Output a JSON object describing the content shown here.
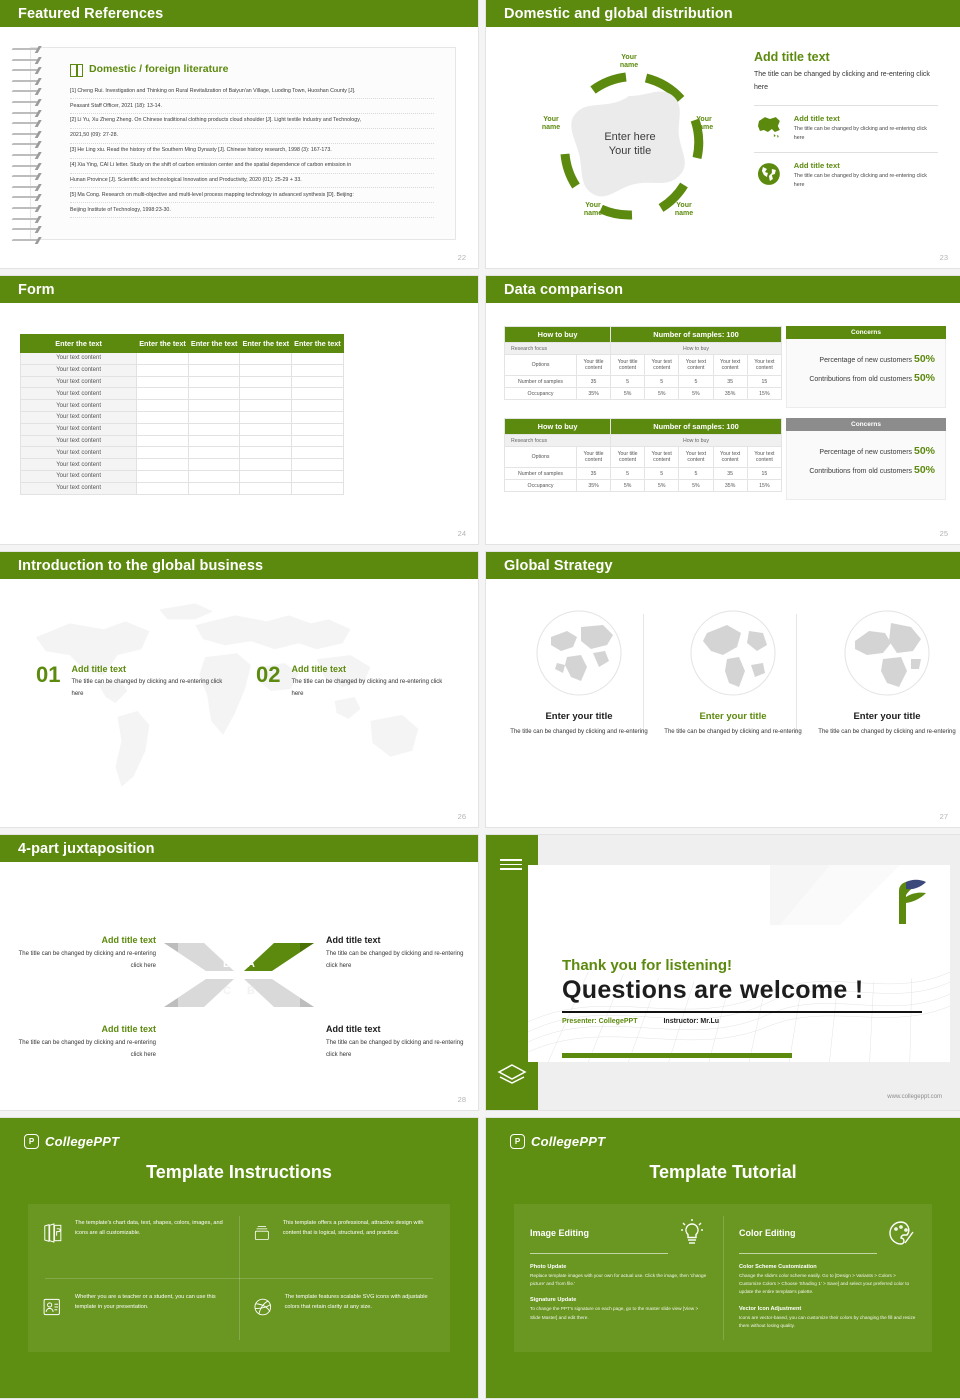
{
  "deck": {
    "brand": "CollegePPT",
    "accent": "#5c8a0e",
    "accent_dark": "#4d7a0a",
    "gray": "#8c8c8c"
  },
  "slides": [
    {
      "id": "featured-references",
      "title": "Featured References",
      "page": "22",
      "section_title": "Domestic / foreign literature",
      "references": [
        "[1] Cheng Rui. Investigation and Thinking on Rural Revitalization of Baiyun'an Village, Luoding Town, Huoshan County [J].",
        "Peasant Staff Officer, 2021 (18): 13-14.",
        "[2] Li Yu, Xu Zheng Zheng. On Chinese traditional clothing products cloud shoulder [J]. Light textile Industry and Technology,",
        "2021,50 (09): 27-28.",
        "[3] He Ling xiu. Read the history of the Southern Ming Dynasty [J]. Chinese history research, 1998 (3): 167-173.",
        "[4] Xia Ying, CAI Li letter. Study on the shift of carbon emission center and the spatial dependence of carbon emission in",
        "Hunan Province [J]. Scientific and technological Innovation and Productivity, 2020 (01): 25-29 + 33.",
        "[5] Ma Cong. Research on multi-objective and multi-level process mapping technology in advanced synthesis [D]. Beijing:",
        "Beijing Institute of Technology, 1998:23-30."
      ]
    },
    {
      "id": "domestic-global-distribution",
      "title": "Domestic and global distribution",
      "page": "23",
      "center": {
        "line1": "Enter here",
        "line2": "Your title"
      },
      "nodes": [
        {
          "line1": "Your",
          "line2": "name"
        },
        {
          "line1": "Your",
          "line2": "name"
        },
        {
          "line1": "Your",
          "line2": "name"
        },
        {
          "line1": "Your",
          "line2": "name"
        },
        {
          "line1": "Your",
          "line2": "name"
        },
        {
          "line1": "Your",
          "line2": "name"
        }
      ],
      "lead": {
        "heading": "Add title text",
        "body": "The title can be changed by clicking and re-entering click here"
      },
      "items": [
        {
          "icon": "china-map-icon",
          "heading": "Add title text",
          "body": "The title can be changed by clicking and re-entering click here"
        },
        {
          "icon": "globe-icon",
          "heading": "Add title text",
          "body": "The title can be changed by clicking and re-entering click here"
        }
      ]
    },
    {
      "id": "form",
      "title": "Form",
      "page": "24",
      "table": {
        "headers": [
          "Enter the text",
          "Enter the text",
          "Enter the text",
          "Enter the text",
          "Enter the text"
        ],
        "row_label": "Your text content",
        "row_count": 12
      }
    },
    {
      "id": "data-comparison",
      "title": "Data comparison",
      "page": "25",
      "tables": [
        {
          "head_left": "How to buy",
          "head_right": "Number of samples: 100",
          "sub_left": "Research focus",
          "sub_right": "How to buy",
          "row_labels": [
            "Options",
            "Number of samples",
            "Occupancy"
          ],
          "options": [
            "Your title content",
            "Your title content",
            "Your text content",
            "Your text content",
            "Your text content",
            "Your text content"
          ],
          "samples": [
            "35",
            "5",
            "5",
            "5",
            "35",
            "15"
          ],
          "occupancy": [
            "35%",
            "5%",
            "5%",
            "5%",
            "35%",
            "15%"
          ]
        },
        {
          "head_left": "How to buy",
          "head_right": "Number of samples: 100",
          "sub_left": "Research focus",
          "sub_right": "How to buy",
          "row_labels": [
            "Options",
            "Number of samples",
            "Occupancy"
          ],
          "options": [
            "Your title content",
            "Your title content",
            "Your text content",
            "Your text content",
            "Your text content",
            "Your text content"
          ],
          "samples": [
            "35",
            "5",
            "5",
            "5",
            "35",
            "15"
          ],
          "occupancy": [
            "35%",
            "5%",
            "5%",
            "5%",
            "35%",
            "15%"
          ]
        }
      ],
      "concerns": [
        {
          "header": "Concerns",
          "style": "green",
          "line1_label": "Percentage of new customers",
          "line1_value": "50%",
          "line2_label": "Contributions from old customers",
          "line2_value": "50%"
        },
        {
          "header": "Concerns",
          "style": "gray",
          "line1_label": "Percentage of new customers",
          "line1_value": "50%",
          "line2_label": "Contributions from old customers",
          "line2_value": "50%"
        }
      ]
    },
    {
      "id": "introduction-global-business",
      "title": "Introduction to the global business",
      "page": "26",
      "blocks": [
        {
          "number": "01",
          "heading": "Add title text",
          "body": "The title can be changed by clicking and re-entering click here"
        },
        {
          "number": "02",
          "heading": "Add title text",
          "body": "The title can be changed by clicking and re-entering click here"
        }
      ]
    },
    {
      "id": "global-strategy",
      "title": "Global Strategy",
      "page": "27",
      "columns": [
        {
          "icon": "globe-eurasia-icon",
          "heading": "Enter your title",
          "heading_color": "#1d1d1d",
          "body": "The title can be changed by clicking and re-entering"
        },
        {
          "icon": "globe-americas-icon",
          "heading": "Enter your title",
          "heading_color": "#5c8a0e",
          "body": "The title can be changed by clicking and re-entering"
        },
        {
          "icon": "globe-africa-icon",
          "heading": "Enter your title",
          "heading_color": "#1d1d1d",
          "body": "The title can be changed by clicking and re-entering"
        }
      ]
    },
    {
      "id": "four-part-juxtaposition",
      "title": "4-part juxtaposition",
      "page": "28",
      "letters": [
        "A",
        "B",
        "C",
        "D"
      ],
      "quadrants": [
        {
          "heading": "Add title text",
          "heading_color": "#5c8a0e",
          "body": "The title can be changed by clicking and re-entering click here"
        },
        {
          "heading": "Add title text",
          "heading_color": "#1d1d1d",
          "body": "The title can be changed by clicking and re-entering click here"
        },
        {
          "heading": "Add title text",
          "heading_color": "#5c8a0e",
          "body": "The title can be changed by clicking and re-entering click here"
        },
        {
          "heading": "Add title text",
          "heading_color": "#1d1d1d",
          "body": "The title can be changed by clicking and re-entering click here"
        }
      ]
    },
    {
      "id": "thank-you",
      "thanks": "Thank you for listening!",
      "questions": "Questions are welcome !",
      "presenter": "Presenter: CollegePPT",
      "instructor": "Instructor: Mr.Lu",
      "url": "www.collegeppt.com"
    },
    {
      "id": "template-instructions",
      "logo": "CollegePPT",
      "title": "Template Instructions",
      "cells": [
        {
          "icon": "slides-p-icon",
          "text": "The template's chart data, text, shapes, colors, images, and icons are all customizable."
        },
        {
          "icon": "box-stack-icon",
          "text": "This template offers a professional, attractive design with content that is logical, structured, and practical."
        },
        {
          "icon": "id-card-icon",
          "text": "Whether you are a teacher or a student, you can use this template in your presentation."
        },
        {
          "icon": "dribbble-circle-icon",
          "text": "The template features scalable SVG icons with adjustable colors that retain clarity at any size."
        }
      ]
    },
    {
      "id": "template-tutorial",
      "logo": "CollegePPT",
      "title": "Template Tutorial",
      "panels": [
        {
          "heading": "Image Editing",
          "icon": "lightbulb-icon",
          "sections": [
            {
              "subtitle": "Photo Update",
              "body": "Replace template images with your own for actual use. Click the image, then 'change picture' and 'from file.'"
            },
            {
              "subtitle": "Signature Update",
              "body": "To change the PPT's signature on each page, go to the master slide view [View > Slide Master] and edit there."
            }
          ]
        },
        {
          "heading": "Color Editing",
          "icon": "palette-icon",
          "sections": [
            {
              "subtitle": "Color Scheme Customization",
              "body": "Change the slide's color scheme easily. Go to [Design > Variants > Colors > Customize Colors > Choose 'Shading 1' > Save] and select your preferred color to update the entire template's palette."
            },
            {
              "subtitle": "Vector Icon Adjustment",
              "body": "Icons are vector-based, you can customize their colors by changing the fill and resize them without losing quality."
            }
          ]
        }
      ]
    }
  ]
}
